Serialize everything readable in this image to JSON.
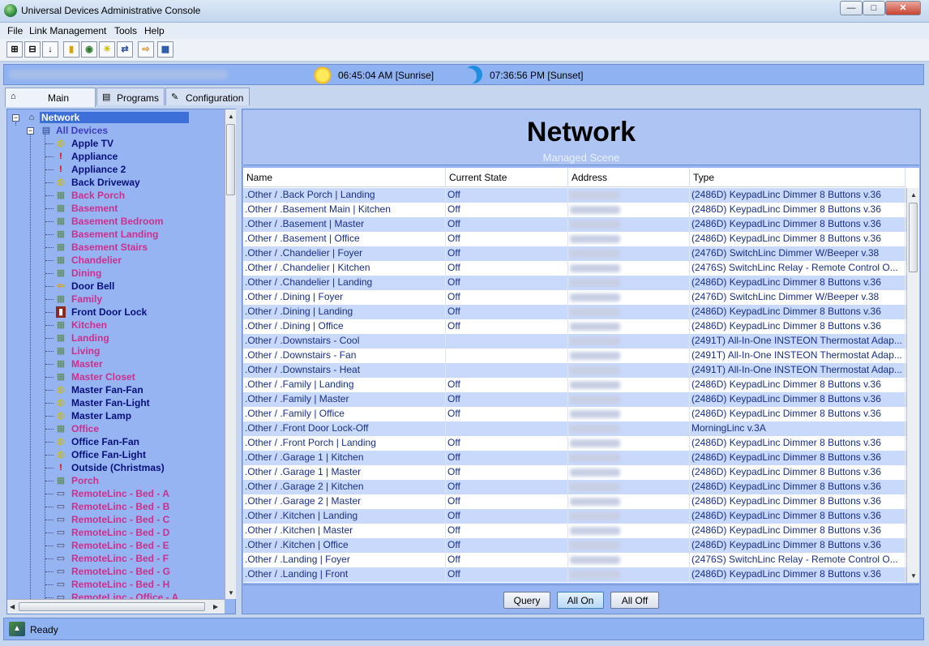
{
  "window": {
    "title": "Universal Devices Administrative Console",
    "min": "—",
    "max": "□",
    "close": "✕"
  },
  "menu": [
    "File",
    "Link Management",
    "Tools",
    "Help"
  ],
  "toolbar": [
    {
      "icon": "expand-icon",
      "glyph": "⊞"
    },
    {
      "icon": "collapse-icon",
      "glyph": "⊟"
    },
    {
      "icon": "sort-az-icon",
      "glyph": "↓"
    },
    {
      "icon": "folder-icon",
      "glyph": "▮"
    },
    {
      "icon": "scene-icon",
      "glyph": "◉"
    },
    {
      "icon": "bulb-icon",
      "glyph": "☀"
    },
    {
      "icon": "link-icon",
      "glyph": "⇄"
    },
    {
      "icon": "arrow-right-icon",
      "glyph": "⇨"
    },
    {
      "icon": "chart-icon",
      "glyph": "▦"
    }
  ],
  "sun": {
    "sunrise": "06:45:04 AM [Sunrise]",
    "sunset": "07:36:56 PM [Sunset]"
  },
  "tabs": [
    {
      "label": "Main",
      "icon": "⌂",
      "active": true
    },
    {
      "label": "Programs",
      "icon": "▤",
      "active": false
    },
    {
      "label": "Configuration",
      "icon": "✎",
      "active": false
    }
  ],
  "tree": {
    "root": "Network",
    "group": "All Devices",
    "items": [
      {
        "label": "Apple TV",
        "icon": "bulb",
        "color": "blue"
      },
      {
        "label": "Appliance",
        "icon": "bang",
        "color": "blue"
      },
      {
        "label": "Appliance 2",
        "icon": "bang",
        "color": "blue"
      },
      {
        "label": "Back Driveway",
        "icon": "bulb",
        "color": "blue"
      },
      {
        "label": "Back Porch",
        "icon": "kpd",
        "color": "pink"
      },
      {
        "label": "Basement",
        "icon": "kpd",
        "color": "pink"
      },
      {
        "label": "Basement Bedroom",
        "icon": "kpd",
        "color": "pink"
      },
      {
        "label": "Basement Landing",
        "icon": "kpd",
        "color": "pink"
      },
      {
        "label": "Basement Stairs",
        "icon": "kpd",
        "color": "pink"
      },
      {
        "label": "Chandelier",
        "icon": "kpd",
        "color": "pink"
      },
      {
        "label": "Dining",
        "icon": "kpd",
        "color": "pink"
      },
      {
        "label": "Door Bell",
        "icon": "arrow",
        "color": "blue"
      },
      {
        "label": "Family",
        "icon": "kpd",
        "color": "pink"
      },
      {
        "label": "Front Door Lock",
        "icon": "lock",
        "color": "blue"
      },
      {
        "label": "Kitchen",
        "icon": "kpd",
        "color": "pink"
      },
      {
        "label": "Landing",
        "icon": "kpd",
        "color": "pink"
      },
      {
        "label": "Living",
        "icon": "kpd",
        "color": "pink"
      },
      {
        "label": "Master",
        "icon": "kpd",
        "color": "pink"
      },
      {
        "label": "Master Closet",
        "icon": "kpd",
        "color": "pink"
      },
      {
        "label": "Master Fan-Fan",
        "icon": "bulb",
        "color": "blue"
      },
      {
        "label": "Master Fan-Light",
        "icon": "bulb",
        "color": "blue"
      },
      {
        "label": "Master Lamp",
        "icon": "bulb",
        "color": "blue"
      },
      {
        "label": "Office",
        "icon": "kpd",
        "color": "pink"
      },
      {
        "label": "Office Fan-Fan",
        "icon": "bulb",
        "color": "blue"
      },
      {
        "label": "Office Fan-Light",
        "icon": "bulb",
        "color": "blue"
      },
      {
        "label": "Outside (Christmas)",
        "icon": "bang",
        "color": "blue"
      },
      {
        "label": "Porch",
        "icon": "kpd",
        "color": "pink"
      },
      {
        "label": "RemoteLinc - Bed - A",
        "icon": "remote",
        "color": "pink"
      },
      {
        "label": "RemoteLinc - Bed - B",
        "icon": "remote",
        "color": "pink"
      },
      {
        "label": "RemoteLinc - Bed - C",
        "icon": "remote",
        "color": "pink"
      },
      {
        "label": "RemoteLinc - Bed - D",
        "icon": "remote",
        "color": "pink"
      },
      {
        "label": "RemoteLinc - Bed - E",
        "icon": "remote",
        "color": "pink"
      },
      {
        "label": "RemoteLinc - Bed - F",
        "icon": "remote",
        "color": "pink"
      },
      {
        "label": "RemoteLinc - Bed - G",
        "icon": "remote",
        "color": "pink"
      },
      {
        "label": "RemoteLinc - Bed - H",
        "icon": "remote",
        "color": "pink"
      },
      {
        "label": "RemoteLinc - Office - A",
        "icon": "remote",
        "color": "pink"
      }
    ]
  },
  "panel": {
    "title": "Network",
    "subtitle": "Managed Scene"
  },
  "table": {
    "columns": [
      "Name",
      "Current State",
      "Address",
      "Type"
    ],
    "rows": [
      [
        ".Other / .Back Porch | Landing",
        "Off",
        "(2486D) KeypadLinc Dimmer 8 Buttons v.36"
      ],
      [
        ".Other / .Basement Main | Kitchen",
        "Off",
        "(2486D) KeypadLinc Dimmer 8 Buttons v.36"
      ],
      [
        ".Other / .Basement | Master",
        "Off",
        "(2486D) KeypadLinc Dimmer 8 Buttons v.36"
      ],
      [
        ".Other / .Basement | Office",
        "Off",
        "(2486D) KeypadLinc Dimmer 8 Buttons v.36"
      ],
      [
        ".Other / .Chandelier | Foyer",
        "Off",
        "(2476D) SwitchLinc Dimmer W/Beeper v.38"
      ],
      [
        ".Other / .Chandelier | Kitchen",
        "Off",
        "(2476S) SwitchLinc Relay - Remote Control O..."
      ],
      [
        ".Other / .Chandelier | Landing",
        "Off",
        "(2486D) KeypadLinc Dimmer 8 Buttons v.36"
      ],
      [
        ".Other / .Dining | Foyer",
        "Off",
        "(2476D) SwitchLinc Dimmer W/Beeper v.38"
      ],
      [
        ".Other / .Dining | Landing",
        "Off",
        "(2486D) KeypadLinc Dimmer 8 Buttons v.36"
      ],
      [
        ".Other / .Dining | Office",
        "Off",
        "(2486D) KeypadLinc Dimmer 8 Buttons v.36"
      ],
      [
        ".Other / .Downstairs - Cool",
        "",
        "(2491T) All-In-One INSTEON Thermostat Adap..."
      ],
      [
        ".Other / .Downstairs - Fan",
        "",
        "(2491T) All-In-One INSTEON Thermostat Adap..."
      ],
      [
        ".Other / .Downstairs - Heat",
        "",
        "(2491T) All-In-One INSTEON Thermostat Adap..."
      ],
      [
        ".Other / .Family | Landing",
        "Off",
        "(2486D) KeypadLinc Dimmer 8 Buttons v.36"
      ],
      [
        ".Other / .Family | Master",
        "Off",
        "(2486D) KeypadLinc Dimmer 8 Buttons v.36"
      ],
      [
        ".Other / .Family | Office",
        "Off",
        "(2486D) KeypadLinc Dimmer 8 Buttons v.36"
      ],
      [
        ".Other / .Front Door Lock-Off",
        "",
        "MorningLinc v.3A"
      ],
      [
        ".Other / .Front Porch | Landing",
        "Off",
        "(2486D) KeypadLinc Dimmer 8 Buttons v.36"
      ],
      [
        ".Other / .Garage 1 | Kitchen",
        "Off",
        "(2486D) KeypadLinc Dimmer 8 Buttons v.36"
      ],
      [
        ".Other / .Garage 1 | Master",
        "Off",
        "(2486D) KeypadLinc Dimmer 8 Buttons v.36"
      ],
      [
        ".Other / .Garage 2 | Kitchen",
        "Off",
        "(2486D) KeypadLinc Dimmer 8 Buttons v.36"
      ],
      [
        ".Other / .Garage 2 | Master",
        "Off",
        "(2486D) KeypadLinc Dimmer 8 Buttons v.36"
      ],
      [
        ".Other / .Kitchen | Landing",
        "Off",
        "(2486D) KeypadLinc Dimmer 8 Buttons v.36"
      ],
      [
        ".Other / .Kitchen | Master",
        "Off",
        "(2486D) KeypadLinc Dimmer 8 Buttons v.36"
      ],
      [
        ".Other / .Kitchen | Office",
        "Off",
        "(2486D) KeypadLinc Dimmer 8 Buttons v.36"
      ],
      [
        ".Other / .Landing | Foyer",
        "Off",
        "(2476S) SwitchLinc Relay - Remote Control O..."
      ],
      [
        ".Other / .Landing | Front",
        "Off",
        "(2486D) KeypadLinc Dimmer 8 Buttons v.36"
      ]
    ]
  },
  "buttons": {
    "query": "Query",
    "all_on": "All On",
    "all_off": "All Off"
  },
  "status": {
    "text": "Ready"
  },
  "colors": {
    "tree_bg": "#97b4f2",
    "row_alt": "#c9d9fb",
    "link_blue": "#06107a",
    "pink": "#cc2f8d"
  }
}
